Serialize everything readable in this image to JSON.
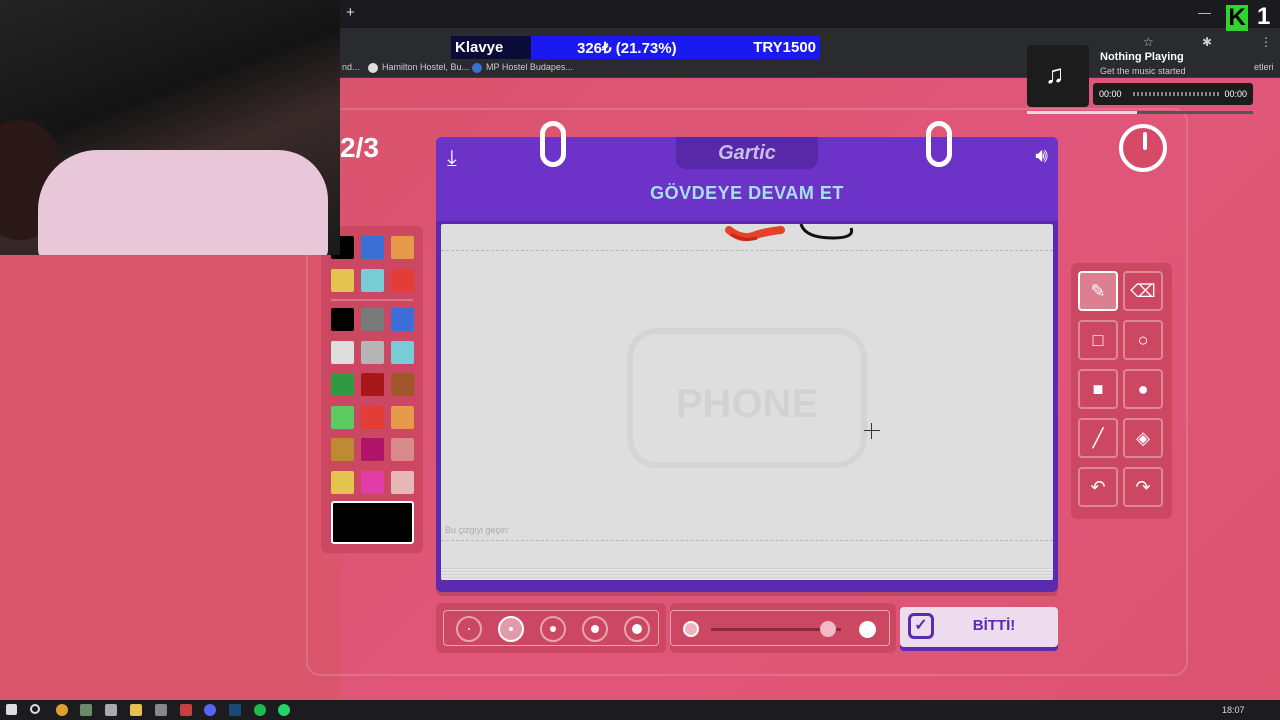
{
  "browser": {
    "bookmarks": [
      "nd...",
      "Hamilton Hostel, Bu...",
      "MP Hostel Budapes...",
      "etleri"
    ]
  },
  "overlay": {
    "name": "Klavye",
    "amount": "326₺ (21.73%)",
    "goal": "TRY1500",
    "logo_letter": "K",
    "logo_number": "1"
  },
  "music": {
    "title": "Nothing Playing",
    "subtitle": "Get the music started",
    "time_start": "00:00",
    "time_end": "00:00"
  },
  "game": {
    "round": "2/3",
    "logo": "Gartic",
    "instruction": "GÖVDEYE DEVAM ET",
    "hint": "Bu çizgiyi geçin:",
    "watermark": "PHONE",
    "done_label": "BİTTİ!"
  },
  "palette": {
    "top_colors": [
      "#000000",
      "#3b6fd6",
      "#e69a4a",
      "#e2c44e",
      "#78ccd6",
      "#e43c36"
    ],
    "grid_colors": [
      "#000000",
      "#7a7a7a",
      "#3b6fd6",
      "#dedede",
      "#b5b5b5",
      "#78ccd6",
      "#2f9a40",
      "#a81818",
      "#a0582a",
      "#5ccc62",
      "#e43c36",
      "#e69a4a",
      "#be8a34",
      "#b0146a",
      "#d98a8a",
      "#e2c44e",
      "#e23ca6",
      "#e6b8b8"
    ],
    "current_color": "#000000"
  },
  "tools": [
    {
      "name": "pencil-tool",
      "icon": "✎",
      "active": true
    },
    {
      "name": "eraser-tool",
      "icon": "⌫",
      "active": false
    },
    {
      "name": "rectangle-outline-tool",
      "icon": "□",
      "active": false
    },
    {
      "name": "ellipse-outline-tool",
      "icon": "○",
      "active": false
    },
    {
      "name": "rectangle-fill-tool",
      "icon": "■",
      "active": false
    },
    {
      "name": "ellipse-fill-tool",
      "icon": "●",
      "active": false
    },
    {
      "name": "line-tool",
      "icon": "╱",
      "active": false
    },
    {
      "name": "fill-bucket-tool",
      "icon": "◈",
      "active": false
    },
    {
      "name": "undo-tool",
      "icon": "↶",
      "active": false
    },
    {
      "name": "redo-tool",
      "icon": "↷",
      "active": false
    }
  ],
  "brush_sizes": {
    "count": 5,
    "active_index": 1
  },
  "opacity": {
    "value": 0.9
  },
  "taskbar": {
    "clock": "18:07"
  }
}
